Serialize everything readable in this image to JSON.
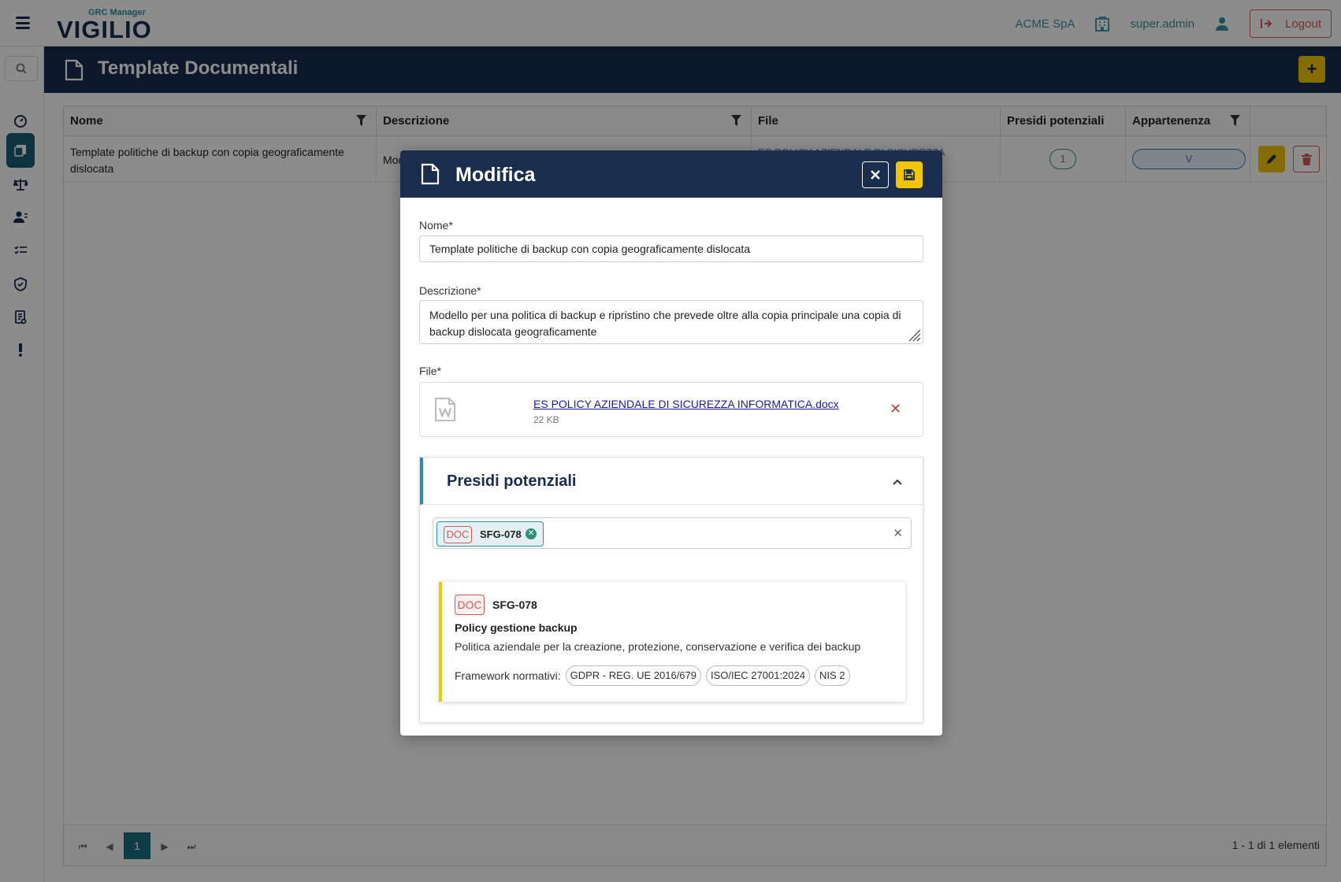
{
  "app": {
    "logo_sub": "GRC Manager",
    "logo_main": "VIGILIO",
    "company": "ACME SpA",
    "user": "super.admin",
    "logout_label": "Logout"
  },
  "sidebar": {
    "items": [
      {
        "name": "dashboard-icon"
      },
      {
        "name": "documents-icon",
        "active": true
      },
      {
        "name": "balance-icon"
      },
      {
        "name": "users-icon"
      },
      {
        "name": "checklist-icon"
      },
      {
        "name": "shield-check-icon"
      },
      {
        "name": "report-icon"
      },
      {
        "name": "alert-icon"
      }
    ]
  },
  "page": {
    "title": "Template Documentali",
    "add_label": "+"
  },
  "table": {
    "columns": [
      "Nome",
      "Descrizione",
      "File",
      "Presidi potenziali",
      "Appartenenza"
    ],
    "rows": [
      {
        "nome": "Template politiche di backup con copia geograficamente dislocata",
        "descrizione": "Mod",
        "file": "ES POLICY AZIENDALE DI SICUREZZA",
        "presidi": "1",
        "appartenenza": "V"
      }
    ]
  },
  "pager": {
    "current_page": "1",
    "info": "1 - 1 di 1 elementi"
  },
  "modal": {
    "title": "Modifica",
    "nome_label": "Nome*",
    "nome_value": "Template politiche di backup con copia geograficamente dislocata",
    "descrizione_label": "Descrizione*",
    "descrizione_value": "Modello per una politica di backup e ripristino che prevede oltre alla copia principale una copia di backup dislocata geograficamente",
    "file_label": "File*",
    "file_name": "ES POLICY AZIENDALE DI SICUREZZA INFORMATICA.docx",
    "file_size": "22 KB",
    "presidi": {
      "title": "Presidi potenziali",
      "chip_badge": "DOC",
      "chip_code": "SFG-078",
      "card": {
        "badge": "DOC",
        "code": "SFG-078",
        "title": "Policy gestione backup",
        "description": "Politica aziendale per la creazione, protezione, conservazione e verifica dei backup",
        "framework_label": "Framework normativi:",
        "frameworks": [
          "GDPR - REG. UE 2016/679",
          "ISO/IEC 27001:2024",
          "NIS 2"
        ]
      }
    }
  },
  "colors": {
    "navy": "#1b2d4f",
    "teal": "#2e8fa0",
    "yellow": "#f2c500",
    "danger": "#d45a5a"
  }
}
